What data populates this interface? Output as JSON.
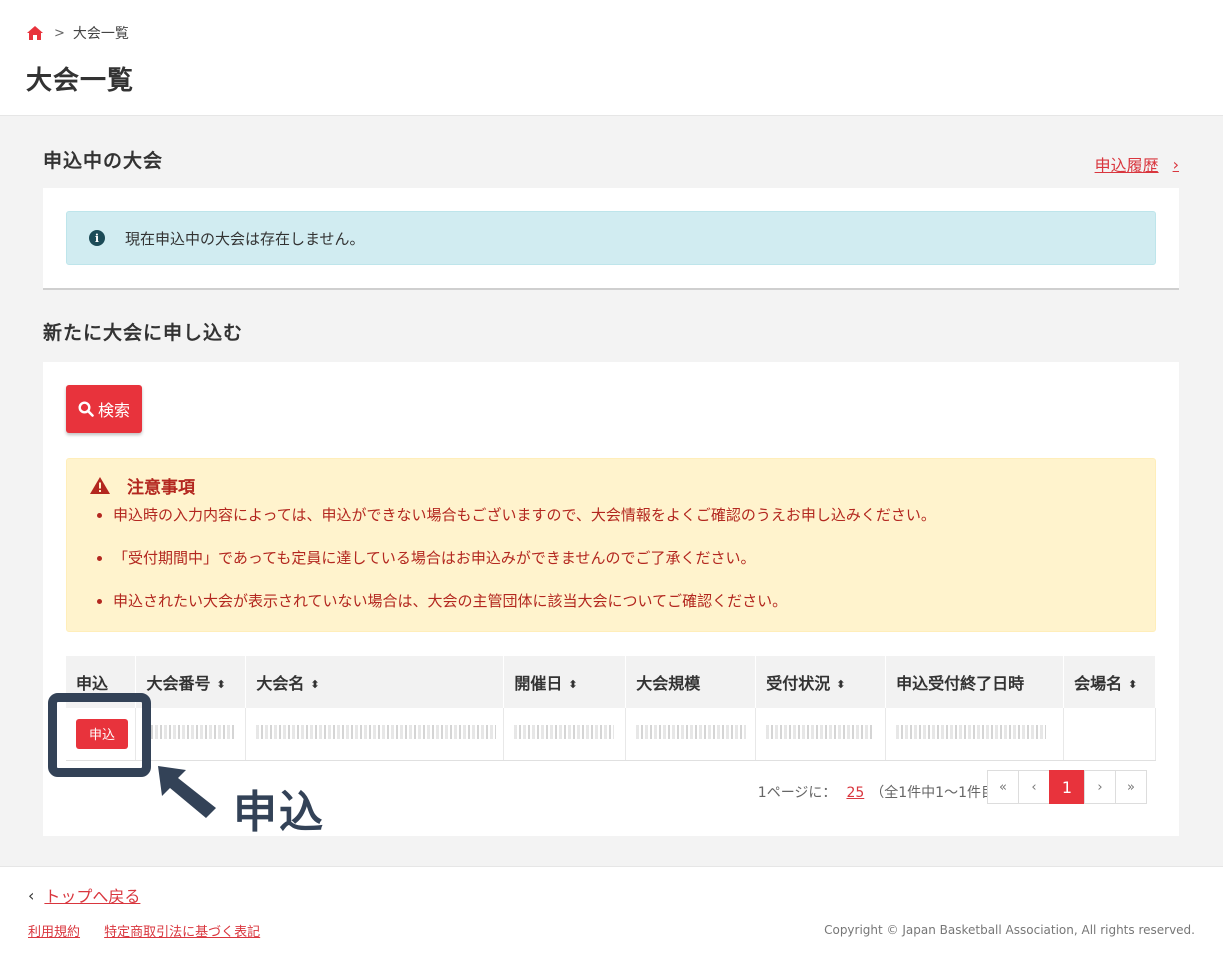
{
  "breadcrumb": {
    "home_icon": "home-icon",
    "separator": ">",
    "current": "大会一覧"
  },
  "page_title": "大会一覧",
  "section_applying": {
    "title": "申込中の大会",
    "history_link": "申込履歴",
    "info_message": "現在申込中の大会は存在しません。"
  },
  "section_new": {
    "title": "新たに大会に申し込む",
    "search_button": "検索",
    "notice": {
      "title": "注意事項",
      "items": [
        "申込時の入力内容によっては、申込ができない場合もございますので、大会情報をよくご確認のうえお申し込みください。",
        "「受付期間中」であっても定員に達している場合はお申込みができませんのでご了承ください。",
        "申込されたい大会が表示されていない場合は、大会の主管団体に該当大会についてご確認ください。"
      ]
    },
    "table": {
      "headers": [
        "申込",
        "大会番号",
        "大会名",
        "開催日",
        "大会規模",
        "受付状況",
        "申込受付終了日時",
        "会場名"
      ],
      "sortable": [
        false,
        true,
        true,
        true,
        false,
        true,
        false,
        true
      ],
      "sort_icon": "⬍",
      "row_apply_label": "申込"
    },
    "pagination": {
      "per_page_label": "1ページに：",
      "per_page_value": "25",
      "summary": "（全1件中1～1件目）",
      "buttons": [
        "«",
        "‹",
        "1",
        "›",
        "»"
      ],
      "current_page": "1"
    }
  },
  "annotation": {
    "label": "申込"
  },
  "footer": {
    "back_link": "トップへ戻る",
    "links": [
      "利用規約",
      "特定商取引法に基づく表記"
    ],
    "copyright": "Copyright © Japan Basketball Association, All rights reserved."
  },
  "colors": {
    "accent": "#e8333c",
    "info_bg": "#d1ecf1",
    "warn_bg": "#fff3cd",
    "annotation": "#334257"
  }
}
